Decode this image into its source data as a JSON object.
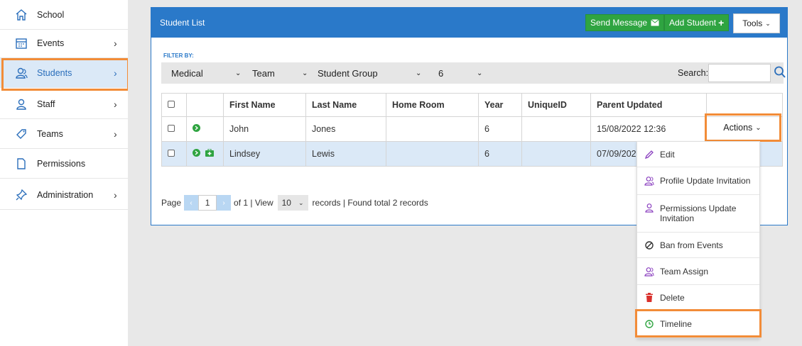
{
  "sidebar": {
    "items": [
      {
        "label": "School",
        "icon": "home-icon"
      },
      {
        "label": "Events",
        "icon": "calendar-icon"
      },
      {
        "label": "Students",
        "icon": "students-icon"
      },
      {
        "label": "Staff",
        "icon": "staff-icon"
      },
      {
        "label": "Teams",
        "icon": "tag-icon"
      },
      {
        "label": "Permissions",
        "icon": "document-icon"
      },
      {
        "label": "Administration",
        "icon": "pushpin-icon"
      }
    ],
    "active": "Students"
  },
  "panel": {
    "title": "Student List",
    "send_message": "Send Message",
    "add_student": "Add Student",
    "tools": "Tools"
  },
  "filter": {
    "label": "FILTER BY:",
    "medical": "Medical",
    "team": "Team",
    "student_group": "Student Group",
    "year": "6",
    "search_label": "Search:"
  },
  "table": {
    "headers": [
      "First Name",
      "Last Name",
      "Home Room",
      "Year",
      "UniqueID",
      "Parent Updated"
    ],
    "rows": [
      {
        "first": "John",
        "last": "Jones",
        "home": "",
        "year": "6",
        "uid": "",
        "updated": "15/08/2022 12:36"
      },
      {
        "first": "Lindsey",
        "last": "Lewis",
        "home": "",
        "year": "6",
        "uid": "",
        "updated": "07/09/202"
      }
    ]
  },
  "pager": {
    "page": "Page",
    "page_num": "1",
    "of": "of 1 | View",
    "view": "10",
    "records": "records | Found total 2 records"
  },
  "actions": {
    "label": "Actions",
    "menu": [
      {
        "label": "Edit",
        "icon": "pencil-icon"
      },
      {
        "label": "Profile Update Invitation",
        "icon": "group-icon"
      },
      {
        "label": "Permissions Update Invitation",
        "icon": "person-icon"
      },
      {
        "label": "Ban from Events",
        "icon": "ban-icon"
      },
      {
        "label": "Team Assign",
        "icon": "group-icon"
      },
      {
        "label": "Delete",
        "icon": "trash-icon"
      },
      {
        "label": "Timeline",
        "icon": "clock-icon"
      }
    ]
  },
  "colors": {
    "accent": "#2a79c9",
    "green": "#2fa441",
    "highlight": "#f28c38",
    "purple": "#8a3fbf"
  }
}
